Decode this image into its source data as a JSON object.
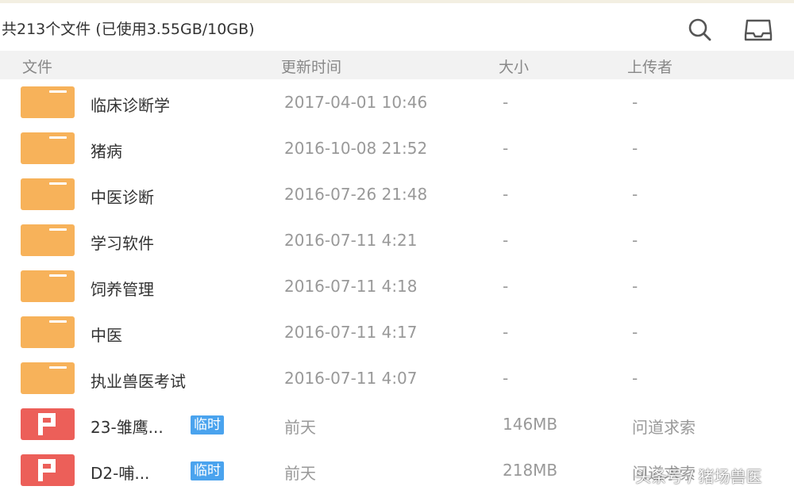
{
  "header": {
    "summary": "共213个文件 (已使用3.55GB/10GB)"
  },
  "columns": {
    "name": "文件",
    "time": "更新时间",
    "size": "大小",
    "uploader": "上传者"
  },
  "files": [
    {
      "type": "folder",
      "name": "临床诊断学",
      "time": "2017-04-01 10:46",
      "size": "-",
      "uploader": "-"
    },
    {
      "type": "folder",
      "name": "猪病",
      "time": "2016-10-08 21:52",
      "size": "-",
      "uploader": "-"
    },
    {
      "type": "folder",
      "name": "中医诊断",
      "time": "2016-07-26 21:48",
      "size": "-",
      "uploader": "-"
    },
    {
      "type": "folder",
      "name": "学习软件",
      "time": "2016-07-11 4:21",
      "size": "-",
      "uploader": "-"
    },
    {
      "type": "folder",
      "name": "饲养管理",
      "time": "2016-07-11 4:18",
      "size": "-",
      "uploader": "-"
    },
    {
      "type": "folder",
      "name": "中医",
      "time": "2016-07-11 4:17",
      "size": "-",
      "uploader": "-"
    },
    {
      "type": "folder",
      "name": "执业兽医考试",
      "time": "2016-07-11 4:07",
      "size": "-",
      "uploader": "-"
    },
    {
      "type": "ppt",
      "name": "23-雏鹰...",
      "badge": "临时",
      "time": "前天",
      "size": "146MB",
      "uploader": "问道求索"
    },
    {
      "type": "ppt",
      "name": "D2-哺...",
      "badge": "临时",
      "time": "前天",
      "size": "218MB",
      "uploader": "问道求索"
    }
  ],
  "watermark": "头条号 / 猪场兽医",
  "icons": {
    "search": "search-icon",
    "inbox": "inbox-icon",
    "folder": "folder-icon",
    "ppt": "ppt-file-icon"
  },
  "colors": {
    "folder": "#f7b25a",
    "ppt": "#ec5f59",
    "badge": "#4aa3ee",
    "header_bg": "#f2f2f2"
  }
}
